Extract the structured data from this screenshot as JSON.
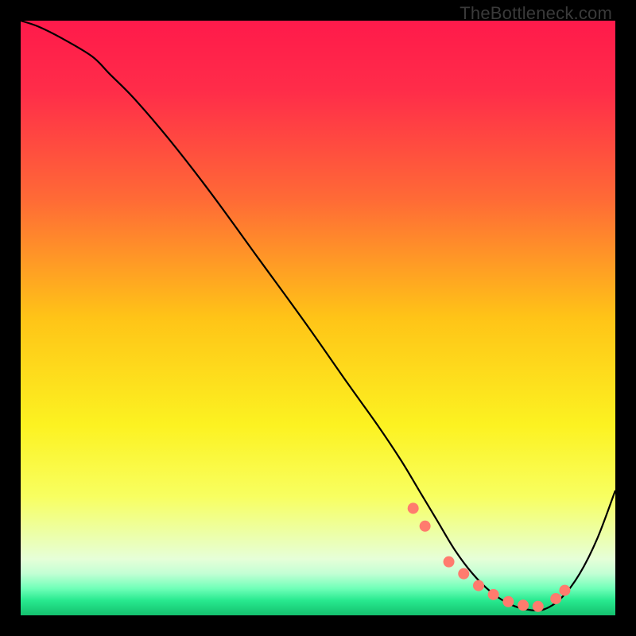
{
  "watermark": "TheBottleneck.com",
  "chart_data": {
    "type": "line",
    "title": "",
    "xlabel": "",
    "ylabel": "",
    "xlim": [
      0,
      100
    ],
    "ylim": [
      0,
      100
    ],
    "background_gradient": {
      "stops": [
        {
          "offset": 0.0,
          "color": "#ff1a4b"
        },
        {
          "offset": 0.12,
          "color": "#ff2d49"
        },
        {
          "offset": 0.3,
          "color": "#ff6a36"
        },
        {
          "offset": 0.5,
          "color": "#ffc417"
        },
        {
          "offset": 0.68,
          "color": "#fcf221"
        },
        {
          "offset": 0.8,
          "color": "#f8ff60"
        },
        {
          "offset": 0.86,
          "color": "#edffa4"
        },
        {
          "offset": 0.905,
          "color": "#e6ffd8"
        },
        {
          "offset": 0.93,
          "color": "#c2ffd4"
        },
        {
          "offset": 0.955,
          "color": "#6fffb8"
        },
        {
          "offset": 0.975,
          "color": "#28e98f"
        },
        {
          "offset": 1.0,
          "color": "#14c06e"
        }
      ]
    },
    "series": [
      {
        "name": "curve",
        "color": "#000000",
        "width": 2.2,
        "x": [
          0,
          3,
          7,
          12,
          15,
          19,
          25,
          32,
          40,
          48,
          55,
          60,
          64,
          67,
          70,
          73,
          76,
          79,
          82,
          85,
          88,
          91,
          94,
          97,
          100
        ],
        "y": [
          100,
          99,
          97,
          94,
          91,
          87,
          80,
          71,
          60,
          49,
          39,
          32,
          26,
          21,
          16,
          11,
          7,
          4,
          2,
          1,
          1,
          3,
          7,
          13,
          21
        ]
      }
    ],
    "markers": {
      "name": "highlight-points",
      "color": "#ff7b6e",
      "radius": 7,
      "x": [
        66,
        68,
        72,
        74.5,
        77,
        79.5,
        82,
        84.5,
        87,
        90,
        91.5
      ],
      "y": [
        18,
        15,
        9,
        7,
        5,
        3.5,
        2.3,
        1.7,
        1.5,
        2.8,
        4.2
      ]
    }
  }
}
